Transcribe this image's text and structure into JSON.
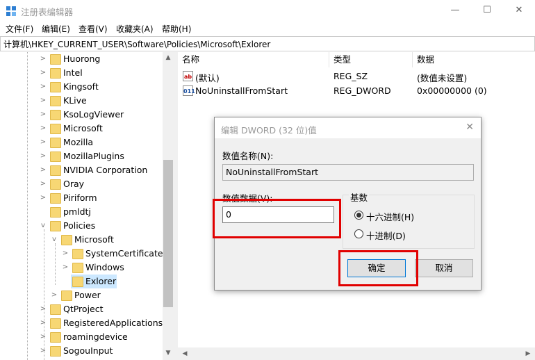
{
  "window": {
    "title": "注册表编辑器",
    "minimize": "—",
    "maximize": "☐",
    "close": "✕"
  },
  "menu": [
    "文件(F)",
    "编辑(E)",
    "查看(V)",
    "收藏夹(A)",
    "帮助(H)"
  ],
  "address": "计算机\\HKEY_CURRENT_USER\\Software\\Policies\\Microsoft\\Exlorer",
  "tree": [
    {
      "label": "Huorong",
      "expanded": false
    },
    {
      "label": "Intel",
      "expanded": false
    },
    {
      "label": "Kingsoft",
      "expanded": false
    },
    {
      "label": "KLive",
      "expanded": false
    },
    {
      "label": "KsoLogViewer",
      "expanded": false
    },
    {
      "label": "Microsoft",
      "expanded": false
    },
    {
      "label": "Mozilla",
      "expanded": false
    },
    {
      "label": "MozillaPlugins",
      "expanded": false
    },
    {
      "label": "NVIDIA Corporation",
      "expanded": false
    },
    {
      "label": "Oray",
      "expanded": false
    },
    {
      "label": "Piriform",
      "expanded": false
    },
    {
      "label": "pmldtj",
      "expanded": false
    },
    {
      "label": "Policies",
      "expanded": true
    },
    {
      "label": "Microsoft",
      "expanded": true
    },
    {
      "label": "SystemCertificates",
      "expanded": false
    },
    {
      "label": "Windows",
      "expanded": false
    },
    {
      "label": "Exlorer",
      "selected": true
    },
    {
      "label": "Power",
      "expanded": false
    },
    {
      "label": "QtProject",
      "expanded": false
    },
    {
      "label": "RegisteredApplications",
      "expanded": false
    },
    {
      "label": "roamingdevice",
      "expanded": false
    },
    {
      "label": "SogouInput",
      "expanded": false
    }
  ],
  "columns": {
    "name": "名称",
    "type": "类型",
    "data": "数据"
  },
  "values": [
    {
      "icon": "ab",
      "name": "(默认)",
      "type": "REG_SZ",
      "data": "(数值未设置)"
    },
    {
      "icon": "011",
      "name": "NoUninstallFromStart",
      "type": "REG_DWORD",
      "data": "0x00000000 (0)"
    }
  ],
  "dialog": {
    "title": "编辑 DWORD (32 位)值",
    "close": "✕",
    "name_label": "数值名称(N):",
    "name_value": "NoUninstallFromStart",
    "data_label": "数值数据(V):",
    "data_value": "0",
    "base_label": "基数",
    "hex_label": "十六进制(H)",
    "dec_label": "十进制(D)",
    "base_selected": "hex",
    "ok_label": "确定",
    "cancel_label": "取消"
  },
  "colors": {
    "highlight": "#e10000",
    "selection": "#cce8ff",
    "folder": "#f7d774"
  }
}
